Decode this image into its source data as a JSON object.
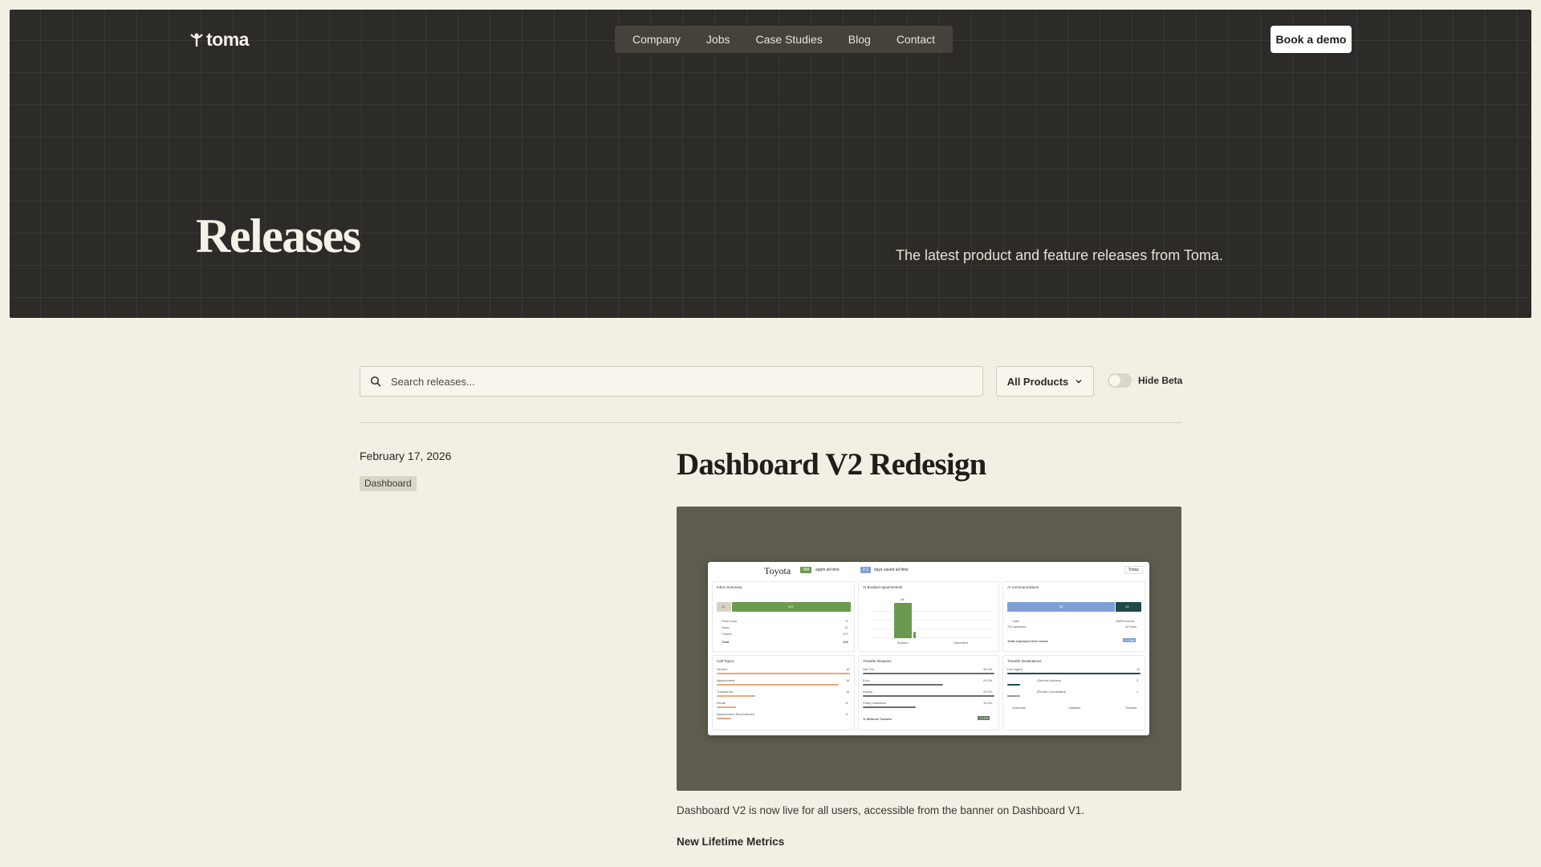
{
  "header": {
    "logo_text": "toma",
    "nav": [
      "Company",
      "Jobs",
      "Case Studies",
      "Blog",
      "Contact"
    ],
    "cta_label": "Book a demo"
  },
  "hero": {
    "title": "Releases",
    "subtitle": "The latest product and feature releases from Toma."
  },
  "filters": {
    "search_placeholder": "Search releases...",
    "search_value": "",
    "product_select": "All Products",
    "hide_beta_label": "Hide Beta",
    "hide_beta_on": false
  },
  "release": {
    "date": "February 17, 2026",
    "tag": "Dashboard",
    "title": "Dashboard V2 Redesign",
    "description": "Dashboard V2 is now live for all users, accessible from the banner on Dashboard V1.",
    "subheading": "New Lifetime Metrics"
  },
  "screenshot": {
    "brand": "Toyota",
    "pill1_value": "388",
    "pill1_text": "appts all-time",
    "pill2_value": "2.1",
    "pill2_text": "days saved all-time",
    "today_label": "Today",
    "cards": {
      "inbox": {
        "title": "Inbox Summary",
        "legend": [
          "Final Cons",
          "Open",
          "Closed",
          "Total"
        ],
        "values": [
          "9",
          "12",
          "127",
          "139"
        ],
        "bar_left": "12",
        "bar_right": "107"
      },
      "appointments": {
        "title": "AI Booked Appointments",
        "peak": "28",
        "labels": [
          "Booked",
          "Cancelled"
        ]
      },
      "communications": {
        "title": "AI Communications",
        "bar_left": "55",
        "bar_right": "12",
        "legend": [
          "Calls",
          "SMS/Convos"
        ],
        "sub": [
          "722 sessions",
          "42 texts"
        ],
        "footer": "Total employee time saved",
        "badge": "2.1 hrs"
      },
      "topics": {
        "title": "Call Topics",
        "items": [
          "Service",
          "Appointment",
          "Transferred",
          "Recall",
          "Appointment Rescheduled"
        ],
        "values": [
          "19",
          "16",
          "14",
          "6",
          "5"
        ]
      },
      "reasons": {
        "title": "Transfer Reasons",
        "items": [
          "Opt Out",
          "Error",
          "Inquiry",
          "Policy Limitation"
        ],
        "values": [
          "33.3%",
          "20.0%",
          "20.0%",
          "13.3%"
        ],
        "footer": "% Without Transfer",
        "badge": "71.1%"
      },
      "destinations": {
        "title": "Transfer Destinations",
        "items": [
          "Live Agent",
          "(Service Advisor)",
          "(Rental Coordinator)"
        ],
        "values": [
          "11",
          "3",
          "1"
        ],
        "legend": [
          "Voicemail",
          "Callback",
          "Transfer"
        ]
      }
    }
  },
  "colors": {
    "hero_bg": "#2d2b27",
    "page_bg": "#f2f0e4",
    "green": "#6a9a4e",
    "blue": "#7f9fd6",
    "teal": "#1f4a4a",
    "orange": "#e9a877"
  }
}
